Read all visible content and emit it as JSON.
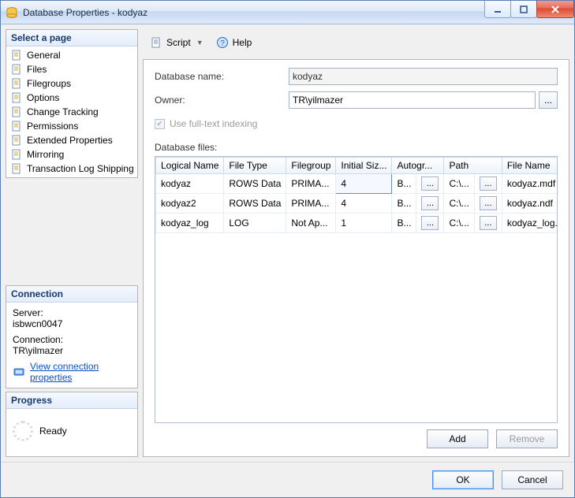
{
  "title": "Database Properties - kodyaz",
  "left": {
    "select_page": "Select a page",
    "pages": [
      {
        "label": "General"
      },
      {
        "label": "Files"
      },
      {
        "label": "Filegroups"
      },
      {
        "label": "Options"
      },
      {
        "label": "Change Tracking"
      },
      {
        "label": "Permissions"
      },
      {
        "label": "Extended Properties"
      },
      {
        "label": "Mirroring"
      },
      {
        "label": "Transaction Log Shipping"
      }
    ],
    "connection_head": "Connection",
    "server_lbl": "Server:",
    "server_val": "isbwcn0047",
    "conn_lbl": "Connection:",
    "conn_val": "TR\\yilmazer",
    "view_conn": "View connection properties",
    "progress_head": "Progress",
    "progress_val": "Ready"
  },
  "toolbar": {
    "script": "Script",
    "help": "Help"
  },
  "form": {
    "dbname_lbl": "Database name:",
    "dbname_val": "kodyaz",
    "owner_lbl": "Owner:",
    "owner_val": "TR\\yilmazer",
    "owner_btn": "...",
    "fulltext_lbl": "Use full-text indexing",
    "files_lbl": "Database files:"
  },
  "grid": {
    "headers": {
      "logical": "Logical Name",
      "filetype": "File Type",
      "filegroup": "Filegroup",
      "initsize": "Initial Siz...",
      "autogrow": "Autogr...",
      "path": "Path",
      "filename": "File Name"
    },
    "rows": [
      {
        "logical": "kodyaz",
        "filetype": "ROWS Data",
        "filegroup": "PRIMA...",
        "initsize": "4",
        "autogrow": "B...",
        "path": "C:\\...",
        "filename": "kodyaz.mdf",
        "edit": true
      },
      {
        "logical": "kodyaz2",
        "filetype": "ROWS Data",
        "filegroup": "PRIMA...",
        "initsize": "4",
        "autogrow": "B...",
        "path": "C:\\...",
        "filename": "kodyaz.ndf"
      },
      {
        "logical": "kodyaz_log",
        "filetype": "LOG",
        "filegroup": "Not Ap...",
        "initsize": "1",
        "autogrow": "B...",
        "path": "C:\\...",
        "filename": "kodyaz_log.ldf"
      }
    ],
    "cellbtn": "..."
  },
  "buttons": {
    "add": "Add",
    "remove": "Remove",
    "ok": "OK",
    "cancel": "Cancel"
  }
}
